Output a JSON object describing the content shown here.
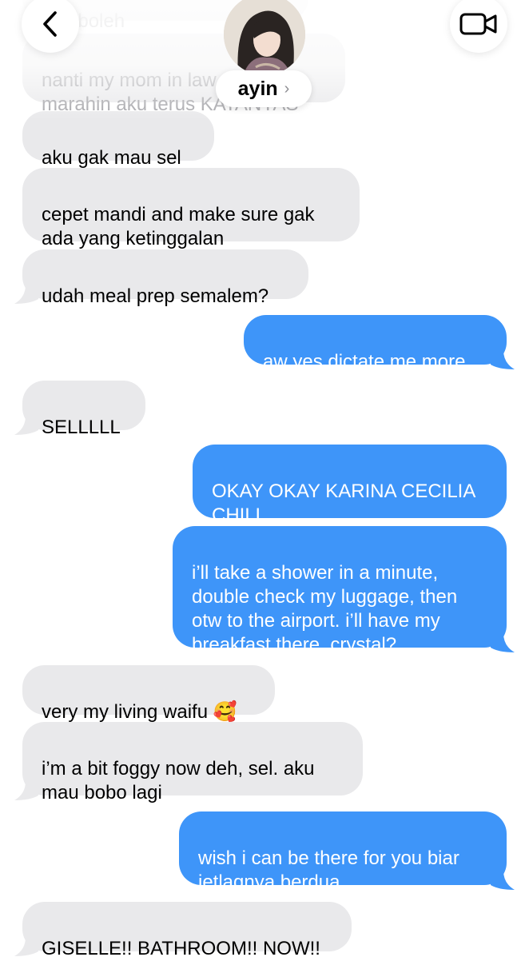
{
  "header": {
    "contact_name": "ayin",
    "name_chevron": "›",
    "back_icon": "chevron-left-icon",
    "video_icon": "video-camera-icon"
  },
  "colors": {
    "incoming_bubble": "#e9e9eb",
    "outgoing_bubble": "#3e95f9"
  },
  "messages": [
    {
      "direction": "incoming",
      "text": "gak boleh"
    },
    {
      "direction": "incoming",
      "text": "nanti my mom in law\nmarahin aku terus KATANYAS"
    },
    {
      "direction": "incoming",
      "text": "aku gak mau sel"
    },
    {
      "direction": "incoming",
      "text": "cepet mandi and make sure gak\nada yang ketinggalan"
    },
    {
      "direction": "incoming",
      "text": "udah meal prep semalem?"
    },
    {
      "direction": "outgoing",
      "text": "aw yes dictate me more"
    },
    {
      "direction": "incoming",
      "text": "SELLLLL"
    },
    {
      "direction": "outgoing",
      "text": "OKAY OKAY KARINA CECILIA\nCHILL"
    },
    {
      "direction": "outgoing",
      "text": "i’ll take a shower in a minute,\ndouble check my luggage, then\notw to the airport. i’ll have my\nbreakfast there, crystal?"
    },
    {
      "direction": "incoming",
      "text": "very my living waifu 🥰"
    },
    {
      "direction": "incoming",
      "text": "i’m a bit foggy now deh, sel. aku\nmau bobo lagi"
    },
    {
      "direction": "outgoing",
      "text": "wish i can be there for you biar\njetlagnya berdua"
    },
    {
      "direction": "incoming",
      "text": "GISELLE!! BATHROOM!! NOW!!"
    }
  ]
}
